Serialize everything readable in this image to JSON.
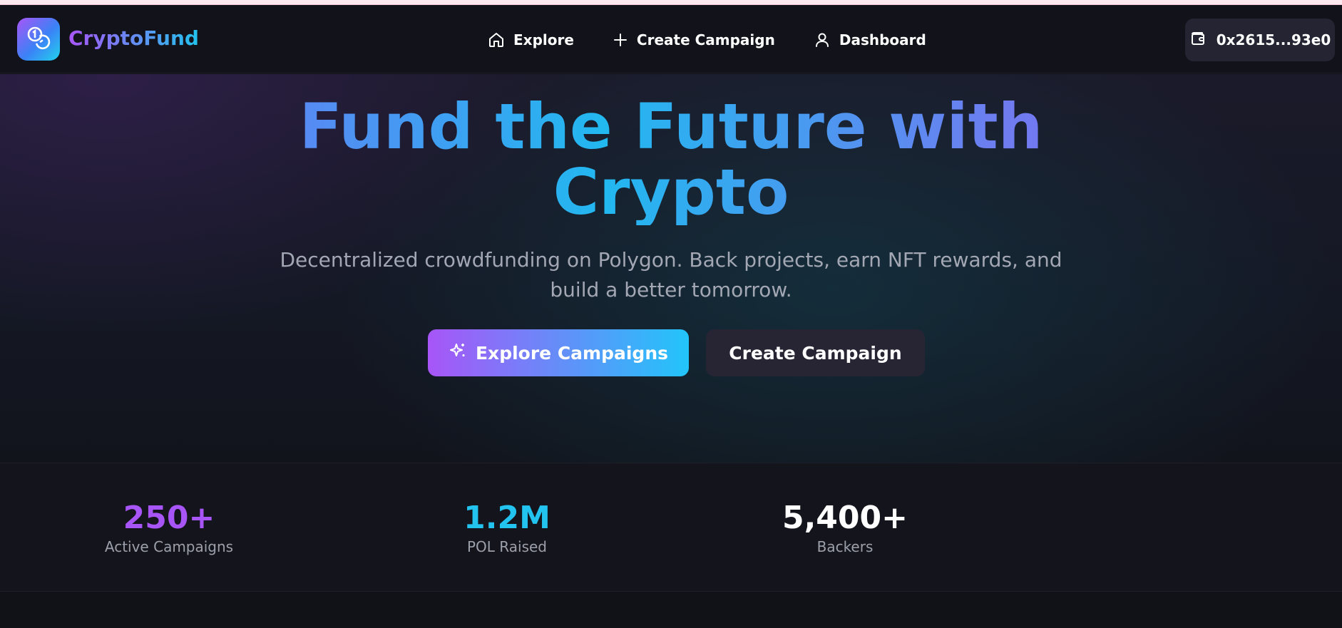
{
  "brand": {
    "name": "CryptoFund",
    "logo_icon": "coins-icon"
  },
  "nav": {
    "items": [
      {
        "label": "Explore",
        "icon": "home-icon"
      },
      {
        "label": "Create Campaign",
        "icon": "plus-icon"
      },
      {
        "label": "Dashboard",
        "icon": "user-icon"
      }
    ]
  },
  "wallet": {
    "address": "0x2615...93e0",
    "icon": "wallet-icon"
  },
  "hero": {
    "title_line1": "Fund the Future with",
    "title_line2": "Crypto",
    "subtitle": "Decentralized crowdfunding on Polygon. Back projects, earn NFT rewards, and build a better tomorrow.",
    "primary_button": "Explore Campaigns",
    "primary_button_icon": "sparkles-icon",
    "secondary_button": "Create Campaign"
  },
  "stats": [
    {
      "value": "250+",
      "label": "Active Campaigns",
      "color": "#a855f7"
    },
    {
      "value": "1.2M",
      "label": "POL Raised",
      "color": "#22c3ee"
    },
    {
      "value": "5,400+",
      "label": "Backers",
      "color": "#ffffff"
    }
  ],
  "colors": {
    "accent_purple": "#a855f7",
    "accent_cyan": "#22c5fa",
    "background": "#12121a"
  }
}
